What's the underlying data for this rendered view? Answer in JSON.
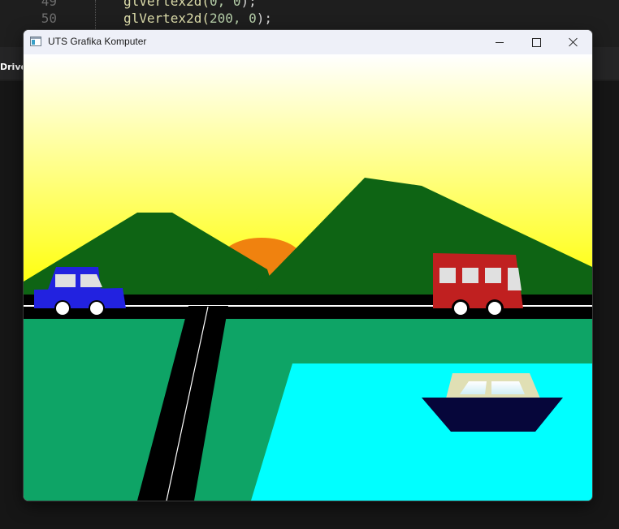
{
  "editor": {
    "line_numbers": [
      "49",
      "50"
    ],
    "code_lines": [
      {
        "fn": "glVertex2d(",
        "args": "0, 0",
        "end": ");"
      },
      {
        "fn": "glVertex2d(",
        "args": "200, 0",
        "end": ");"
      }
    ],
    "side_label": "DriveV"
  },
  "window": {
    "title": "UTS Grafika Komputer",
    "icon": "app-window-icon",
    "controls": [
      "minimize-icon",
      "maximize-icon",
      "close-icon"
    ]
  },
  "scene": {
    "colors": {
      "sky_top": "#ffffff",
      "sky_bottom": "#ffff00",
      "sun": "#f0820f",
      "mountain": "#0e6414",
      "road": "#000000",
      "road_line": "#ffffff",
      "grass": "#0ea466",
      "water": "#00ffff",
      "car_body": "#2222e0",
      "car_window": "#e0e0e0",
      "bus_body": "#c02020",
      "wheel": "#ffffff",
      "boat_hull": "#06063a",
      "boat_cabin": "#e0dfb4",
      "boat_window": "#cfeef5"
    }
  }
}
